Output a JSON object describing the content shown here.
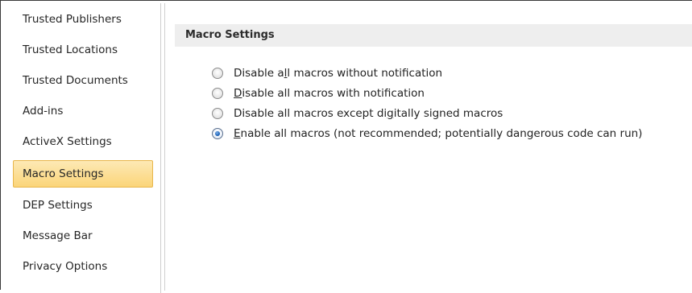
{
  "sidebar": {
    "items": [
      {
        "label": "Trusted Publishers",
        "selected": false
      },
      {
        "label": "Trusted Locations",
        "selected": false
      },
      {
        "label": "Trusted Documents",
        "selected": false
      },
      {
        "label": "Add-ins",
        "selected": false
      },
      {
        "label": "ActiveX Settings",
        "selected": false
      },
      {
        "label": "Macro Settings",
        "selected": true
      },
      {
        "label": "DEP Settings",
        "selected": false
      },
      {
        "label": "Message Bar",
        "selected": false
      },
      {
        "label": "Privacy Options",
        "selected": false
      }
    ]
  },
  "main": {
    "section_title": "Macro Settings",
    "options": [
      {
        "pre": "Disable a",
        "access_key": "l",
        "post": "l macros without notification",
        "checked": false
      },
      {
        "pre": "",
        "access_key": "D",
        "post": "isable all macros with notification",
        "checked": false
      },
      {
        "pre": "Disable all macros except di",
        "access_key": "g",
        "post": "itally signed macros",
        "checked": false
      },
      {
        "pre": "",
        "access_key": "E",
        "post": "nable all macros (not recommended; potentially dangerous code can run)",
        "checked": true
      }
    ]
  },
  "colors": {
    "selected_item_bg": "#fbd579",
    "selected_item_border": "#e8b64a",
    "section_header_bg": "#eeeeee",
    "radio_checked_dot": "#1c62b8"
  }
}
